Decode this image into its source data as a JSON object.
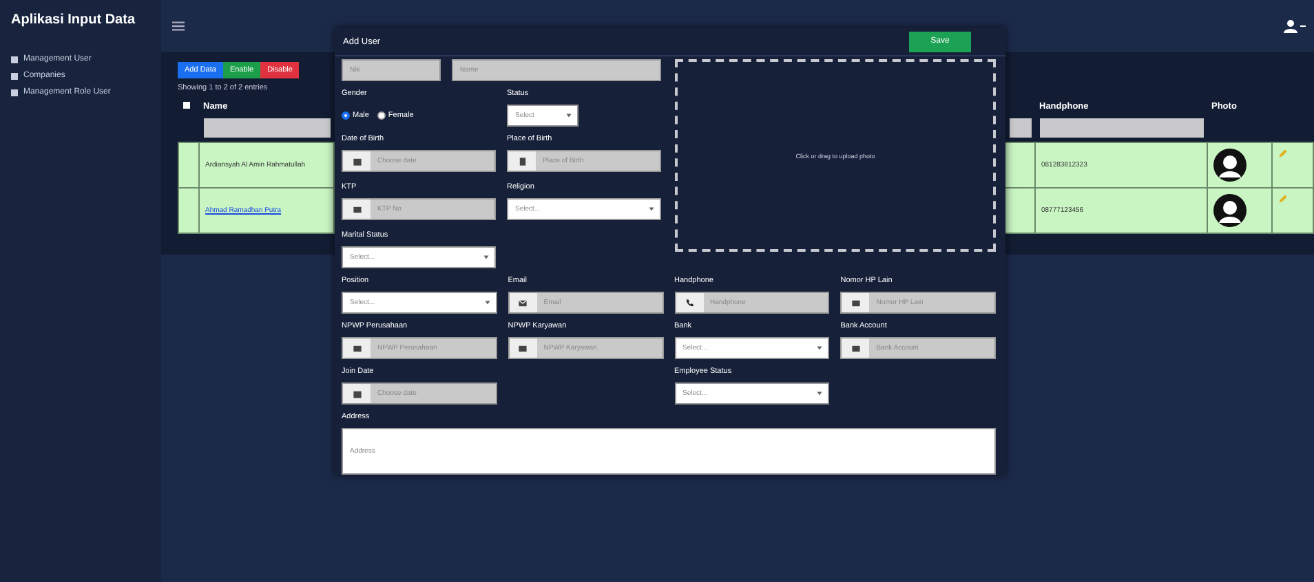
{
  "app_title": "Aplikasi Input Data",
  "sidebar": {
    "items": [
      {
        "label": "Management User",
        "selected": false
      },
      {
        "label": "Companies",
        "selected": false
      },
      {
        "label": "Management Role User",
        "selected": false
      }
    ]
  },
  "table": {
    "buttons": [
      {
        "label": "Add Data",
        "kind": "primary"
      },
      {
        "label": "Enable",
        "kind": "success"
      },
      {
        "label": "Disable",
        "kind": "danger"
      }
    ],
    "info": "Showing 1 to 2 of 2 entries",
    "select_all": {
      "checked": false
    },
    "columns": [
      {
        "label": "Name"
      },
      {
        "label": "Handphone"
      },
      {
        "label": "Photo"
      }
    ],
    "rows": [
      {
        "name": "Ardiansyah Al Amin Rahmatullah",
        "kind": "text",
        "handphone": "081283812323"
      },
      {
        "name": "Ahmad Ramadhan Putra",
        "kind": "link",
        "handphone": "08777123456"
      }
    ]
  },
  "modal": {
    "title": "Add User",
    "save": "Save",
    "nik": {
      "placeholder": "Nik"
    },
    "name": {
      "placeholder": "Name"
    },
    "gender": {
      "label": "Gender",
      "options": [
        {
          "label": "Male",
          "selected": true
        },
        {
          "label": "Female",
          "selected": false
        }
      ]
    },
    "status": {
      "label": "Status",
      "kind": "select",
      "placeholder": "Select"
    },
    "left_fields": [
      {
        "label": "Date of Birth",
        "kind": "date",
        "placeholder": "Choose date"
      },
      {
        "label": "Place of Birth",
        "kind": "place",
        "placeholder": "Place of Birth"
      },
      {
        "label": "KTP",
        "kind": "card",
        "placeholder": "KTP No"
      },
      {
        "label": "Religion",
        "kind": "select",
        "placeholder": "Select..."
      },
      {
        "label": "Marital Status",
        "kind": "select",
        "placeholder": "Select..."
      }
    ],
    "dropzone": "Click or drag to upload photo",
    "grid_fields": [
      {
        "label": "Position",
        "kind": "select",
        "placeholder": "Select..."
      },
      {
        "label": "Email",
        "kind": "email",
        "placeholder": "Email"
      },
      {
        "label": "Handphone",
        "kind": "phone",
        "placeholder": "Handphone"
      },
      {
        "label": "Nomor HP Lain",
        "kind": "card",
        "placeholder": "Nomor HP Lain"
      },
      {
        "label": "NPWP Perusahaan",
        "kind": "card",
        "placeholder": "NPWP Perusahaan"
      },
      {
        "label": "NPWP Karyawan",
        "kind": "card",
        "placeholder": "NPWP Karyawan"
      },
      {
        "label": "Bank",
        "kind": "select",
        "placeholder": "Select..."
      },
      {
        "label": "Bank Account",
        "kind": "card",
        "placeholder": "Bank Account"
      },
      {
        "label": "Join Date",
        "kind": "date",
        "placeholder": "Choose date"
      },
      {
        "kind": "empty"
      },
      {
        "label": "Employee Status",
        "kind": "select",
        "placeholder": "Select..."
      }
    ],
    "address": {
      "label": "Address",
      "placeholder": "Address"
    }
  }
}
